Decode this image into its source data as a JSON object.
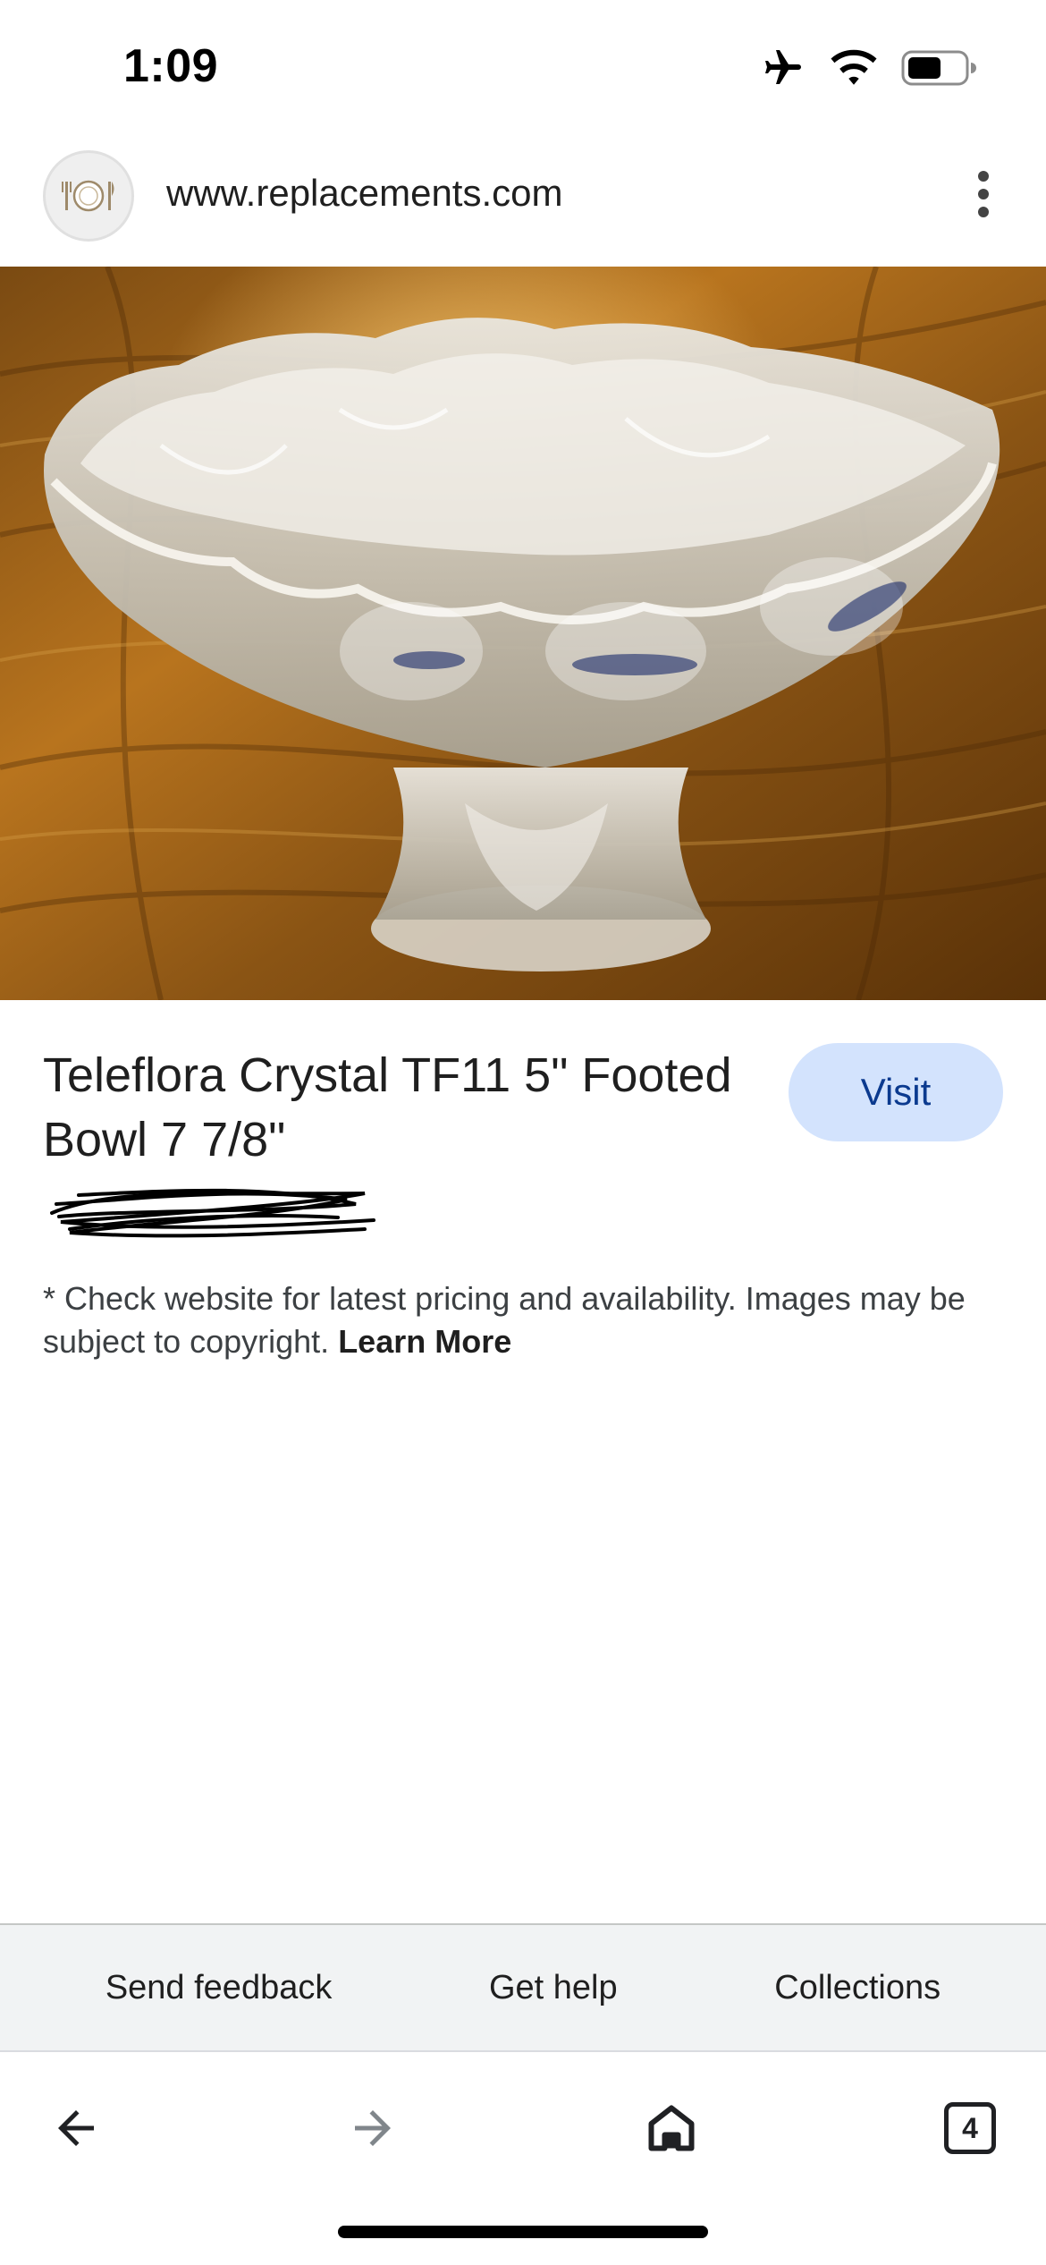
{
  "status_bar": {
    "time": "1:09",
    "icons": [
      "airplane-icon",
      "wifi-icon",
      "battery-icon"
    ]
  },
  "url_bar": {
    "url": "www.replacements.com",
    "favicon": "place-setting-icon",
    "menu_icon": "more-vert-icon"
  },
  "product": {
    "image_alt": "Teleflora Crystal footed glass bowl on wooden table",
    "title": "Teleflora Crystal TF11 5\" Footed Bowl 7 7/8\"",
    "visit_label": "Visit",
    "price_redacted": true,
    "disclaimer": "* Check website for latest pricing and availability. Images may be subject to copyright.",
    "learn_more_label": "Learn More"
  },
  "footer": {
    "send_feedback": "Send feedback",
    "get_help": "Get help",
    "collections": "Collections"
  },
  "toolbar": {
    "back_icon": "arrow-back-icon",
    "forward_icon": "arrow-forward-icon",
    "home_icon": "home-icon",
    "tab_count": "4"
  },
  "colors": {
    "visit_button_bg": "#d3e3fd",
    "visit_button_text": "#0b3a8f",
    "footer_bg": "#f1f3f4"
  }
}
